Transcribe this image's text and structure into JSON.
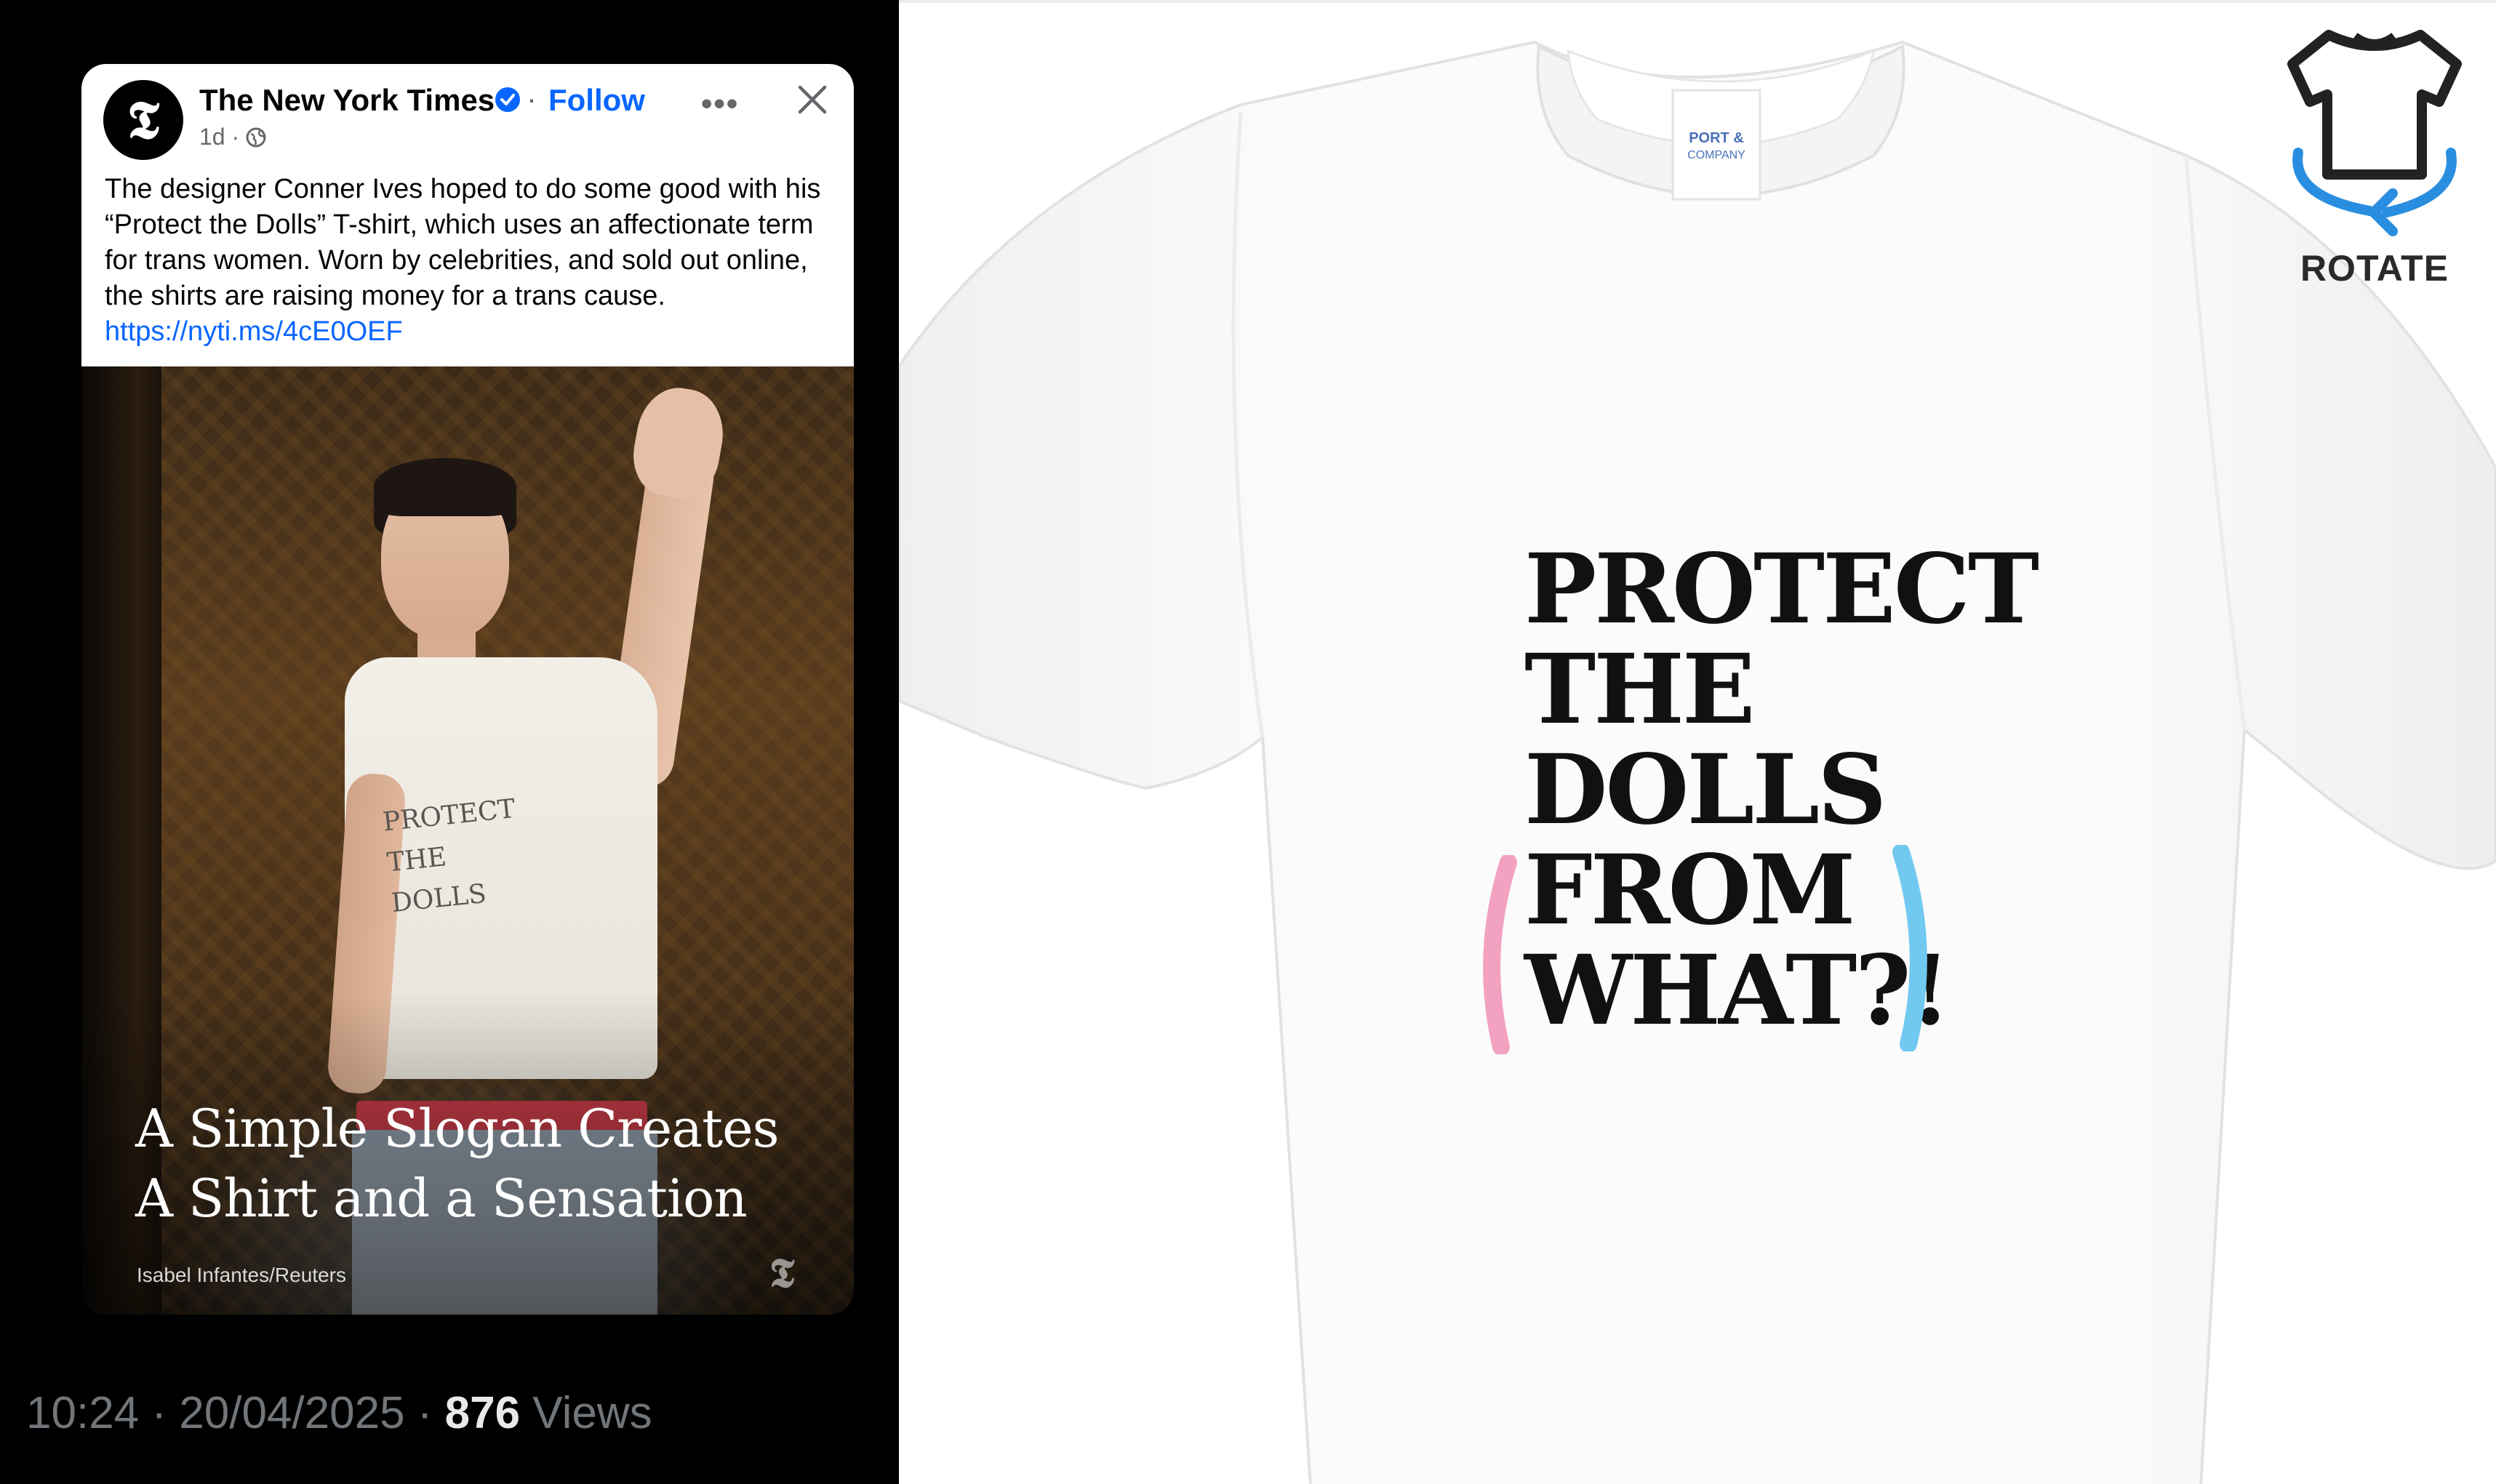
{
  "post": {
    "page_name": "The New York Times",
    "follow_label": "Follow",
    "separator": "·",
    "age": "1d ·",
    "more_label": "•••",
    "text": "The designer Conner Ives hoped to do some good with his “Protect the Dolls” T-shirt, which uses an affectionate term for trans women. Worn by celebrities, and sold out online, the shirts are raising money for a trans cause. ",
    "link": "https://nyti.ms/4cE0OEF",
    "avatar_glyph": "𝕿",
    "photo": {
      "shirt_print": "PROTECT\nTHE\nDOLLS",
      "headline": "A Simple Slogan Creates\nA Shirt and a Sensation",
      "credit": "Isabel Infantes/Reuters",
      "watermark": "𝕿"
    }
  },
  "tweet_meta": {
    "time_date": "10:24 · 20/04/2025 · ",
    "views_count": "876",
    "views_label": " Views"
  },
  "product": {
    "slogan": "PROTECT\nTHE\nDOLLS\nFROM\nWHAT?!",
    "rotate_label": "ROTATE",
    "tag_text": "PORT & COMPANY",
    "colors": {
      "bracket_left": "#f2a2c0",
      "bracket_right": "#72c9f0",
      "rotate_arrow": "#2a8ee0"
    }
  }
}
